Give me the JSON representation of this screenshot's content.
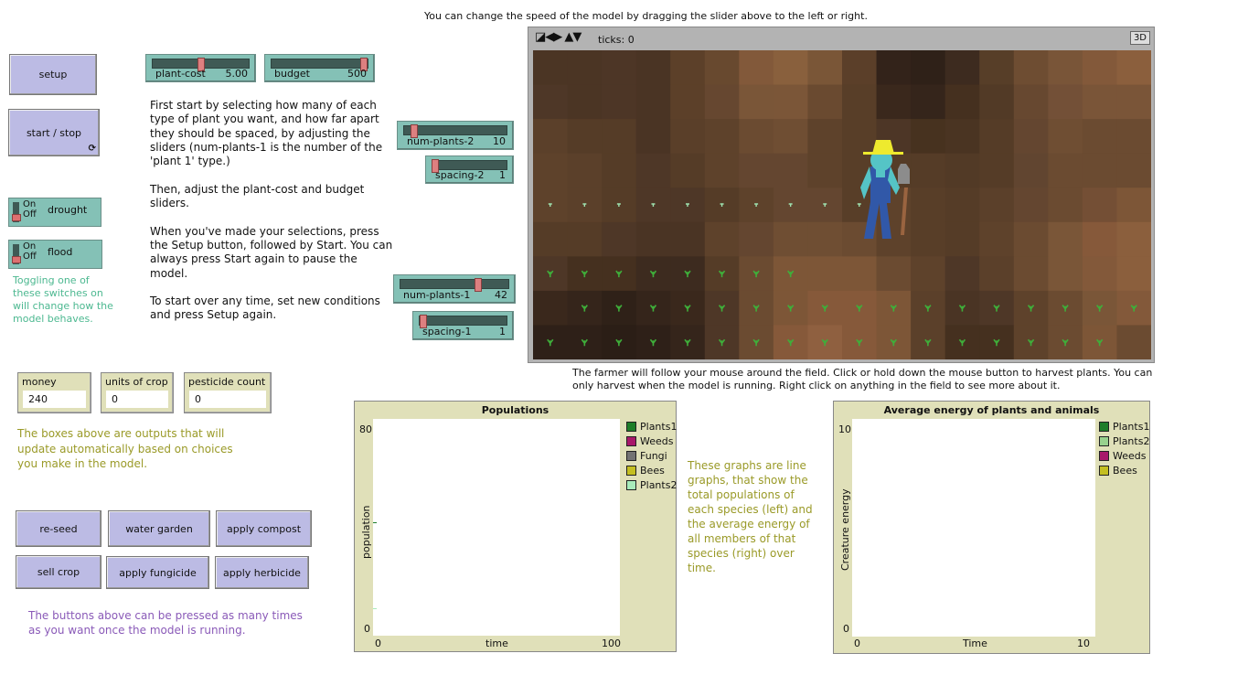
{
  "speed_hint": "You can change the speed of the model by dragging the slider above to the left or right.",
  "buttons": {
    "setup": "setup",
    "start_stop": "start / stop",
    "forever_icon": "forever-arrows-icon"
  },
  "switches": [
    {
      "name": "drought",
      "on_label": "On",
      "off_label": "Off",
      "state": "off"
    },
    {
      "name": "flood",
      "on_label": "On",
      "off_label": "Off",
      "state": "off"
    }
  ],
  "switch_note": "Toggling one of\nthese switches on\nwill change how the\nmodel behaves.",
  "sliders": {
    "plant_cost": {
      "label": "plant-cost",
      "value": "5.00",
      "position_pct": 50
    },
    "budget": {
      "label": "budget",
      "value": "500",
      "position_pct": 100
    },
    "num_plants_2": {
      "label": "num-plants-2",
      "value": "10",
      "position_pct": 10
    },
    "spacing_2": {
      "label": "spacing-2",
      "value": "1",
      "position_pct": 0
    },
    "num_plants_1": {
      "label": "num-plants-1",
      "value": "42",
      "position_pct": 72
    },
    "spacing_1": {
      "label": "spacing-1",
      "value": "1",
      "position_pct": 0
    }
  },
  "instructions": "First start by selecting how many of each\ntype of plant you want, and how far apart\nthey should be spaced, by adjusting the\nsliders (num-plants-1 is the number of the\n'plant 1' type.)\n\nThen, adjust the plant-cost and budget\nsliders.\n\nWhen you've made your selections, press\nthe Setup button, followed by Start. You can\nalways press Start again to pause the\nmodel.\n\nTo start over any time, set new conditions\nand press Setup again.",
  "view": {
    "ticks_label": "ticks: 0",
    "three_d_label": "3D"
  },
  "view_note": "The farmer will follow your mouse around the field. Click or hold down the mouse button to harvest plants. You can\nonly harvest when the model is running. Right click on anything in the field to see more about it.",
  "monitors": [
    {
      "label": "money",
      "value": "240"
    },
    {
      "label": "units of crop",
      "value": "0"
    },
    {
      "label": "pesticide count",
      "value": "0"
    }
  ],
  "monitor_note": "The boxes above are outputs that will\nupdate automatically based on choices\nyou make in the model.",
  "action_buttons": [
    "re-seed",
    "water garden",
    "apply compost",
    "sell crop",
    "apply fungicide",
    "apply herbicide"
  ],
  "buttons_note": "The buttons above can be pressed as many times\nas you want once the model is running.",
  "graphs_note": "These graphs are line\ngraphs, that show the\ntotal populations of\neach species (left) and\nthe average energy of\nall members of that\nspecies (right) over\ntime.",
  "colors": {
    "button": "#bcbbe4",
    "slider": "#84c1b6",
    "monitor": "#e0e0b9",
    "note_green": "#4cb890",
    "note_olive": "#9a9a28",
    "note_purple": "#8a5ab8"
  },
  "plots": [
    {
      "title": "Populations",
      "xlabel": "time",
      "ylabel": "population",
      "xmin": "0",
      "xmax": "100",
      "ymin": "0",
      "ymax": "80",
      "legend": [
        {
          "name": "Plants1",
          "color": "#1e7e2a"
        },
        {
          "name": "Weeds",
          "color": "#a8186a"
        },
        {
          "name": "Fungi",
          "color": "#737373"
        },
        {
          "name": "Bees",
          "color": "#c4bf22"
        },
        {
          "name": "Plants2",
          "color": "#a8ebbb"
        }
      ],
      "points": [
        {
          "series": "Plants1",
          "x": 0,
          "y": 42
        },
        {
          "series": "Plants2",
          "x": 0,
          "y": 10
        }
      ]
    },
    {
      "title": "Average energy of plants and animals",
      "xlabel": "Time",
      "ylabel": "Creature energy",
      "xmin": "0",
      "xmax": "10",
      "ymin": "0",
      "ymax": "10",
      "legend": [
        {
          "name": "Plants1",
          "color": "#1e7e2a"
        },
        {
          "name": "Plants2",
          "color": "#98d18e"
        },
        {
          "name": "Weeds",
          "color": "#a8186a"
        },
        {
          "name": "Bees",
          "color": "#c4bf22"
        }
      ],
      "points": []
    }
  ]
}
